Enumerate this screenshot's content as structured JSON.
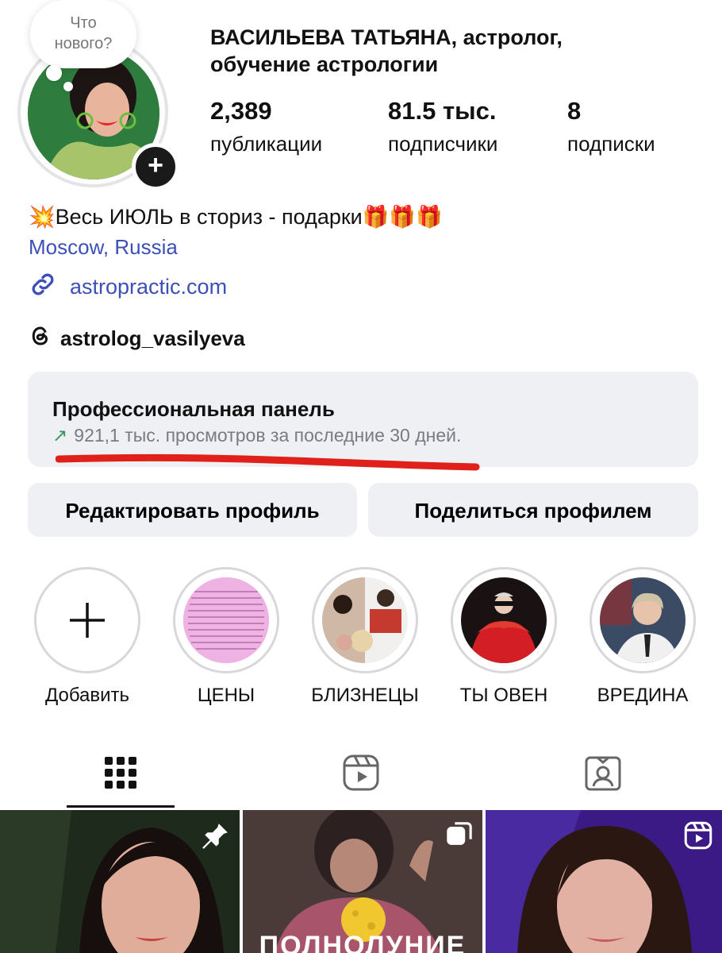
{
  "note": {
    "line1": "Что",
    "line2": "нового?"
  },
  "profile": {
    "name_line1": "ВАСИЛЬЕВА ТАТЬЯНА, астролог,",
    "name_line2": "обучение астрологии"
  },
  "stats": [
    {
      "value": "2,389",
      "label": "публикации"
    },
    {
      "value": "81.5 тыс.",
      "label": "подписчики"
    },
    {
      "value": "8",
      "label": "подписки"
    }
  ],
  "bio": {
    "emoji_start": "💥",
    "text": "Весь ИЮЛЬ в сториз - подарки",
    "emoji_end": "🎁🎁🎁",
    "location": "Moscow, Russia",
    "link": "astropractic.com",
    "threads": "astrolog_vasilyeva"
  },
  "pro_panel": {
    "title": "Профессиональная панель",
    "arrow": "↗",
    "subtitle": "921,1 тыс. просмотров за последние 30 дней."
  },
  "buttons": {
    "edit": "Редактировать профиль",
    "share": "Поделиться профилем"
  },
  "highlights": [
    {
      "label": "Добавить",
      "icon": "plus-icon"
    },
    {
      "label": "ЦЕНЫ"
    },
    {
      "label": "БЛИЗНЕЦЫ"
    },
    {
      "label": "ТЫ ОВЕН"
    },
    {
      "label": "ВРЕДИНА"
    }
  ],
  "tabs": [
    {
      "icon": "grid-icon",
      "active": true
    },
    {
      "icon": "reels-icon"
    },
    {
      "icon": "tagged-icon"
    }
  ],
  "grid": [
    {
      "overlay_icon": "pin-icon"
    },
    {
      "overlay_icon": "carousel-icon",
      "caption": "ПОЛНОЛУНИЕ"
    },
    {
      "overlay_icon": "reels-icon"
    }
  ],
  "colors": {
    "link": "#3d4fb8",
    "panel_bg": "#eff0f3",
    "underline": "#e0201a",
    "arrow": "#2e9b5b"
  }
}
